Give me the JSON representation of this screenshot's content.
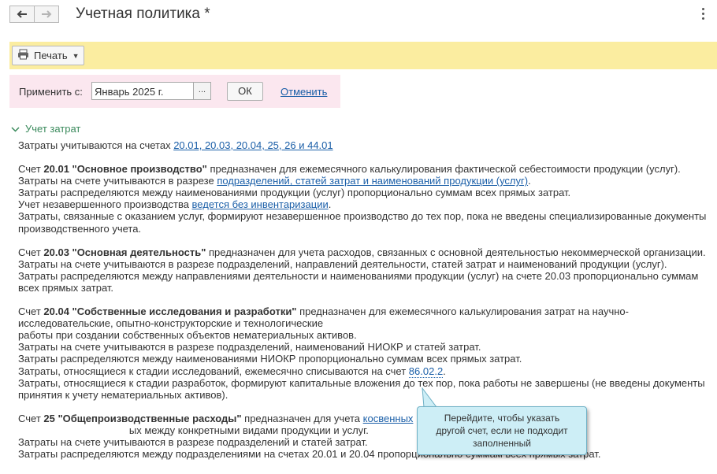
{
  "window": {
    "title": "Учетная политика *"
  },
  "nav": {
    "back_icon": "arrow-left-icon",
    "forward_icon": "arrow-right-icon",
    "more_icon": "more-vertical-icon"
  },
  "toolbar": {
    "print_label": "Печать",
    "print_icon": "printer-icon"
  },
  "apply": {
    "label": "Применить с:",
    "date_value": "Январь 2025 г.",
    "picker_label": "...",
    "ok_label": "ОК",
    "cancel_label": "Отменить"
  },
  "section": {
    "title": "Учет затрат",
    "intro_text": "Затраты учитываются на счетах ",
    "intro_link": "20.01, 20.03, 20.04, 25, 26 и 44.01",
    "b1": {
      "prefix": "Счет ",
      "title": "20.01 \"Основное производство\"",
      "rest": " предназначен для ежемесячного калькулирования фактической себестоимости продукции (услуг).",
      "l2_text": "Затраты на счете учитываются в разрезе ",
      "l2_link": "подразделений, статей затрат и наименований продукции (услуг)",
      "l2_end": ".",
      "l3": "Затраты распределяются между наименованиями продукции (услуг) пропорционально суммам всех прямых затрат.",
      "l4_text": "Учет незавершенного производства ",
      "l4_link": "ведется без инвентаризации",
      "l4_end": ".",
      "l5": "Затраты, связанные с оказанием услуг, формируют незавершенное производство до тех пор, пока не введены специализированные документы производственного учета."
    },
    "b2": {
      "prefix": "Счет ",
      "title": "20.03 \"Основная деятельность\"",
      "rest": " предназначен для учета расходов, связанных с основной деятельностью некоммерческой организации.",
      "l2": "Затраты на счете учитываются в разрезе подразделений, направлений деятельности, статей затрат и наименований продукции (услуг).",
      "l3": "Затраты распределяются между направлениями деятельности и наименованиями продукции (услуг) на счете 20.03 пропорционально суммам всех прямых затрат."
    },
    "b3": {
      "prefix": "Счет ",
      "title": "20.04 \"Собственные исследования и разработки\"",
      "rest": " предназначен для ежемесячного калькулирования затрат на научно-",
      "l1b": "исследовательские, опытно-конструкторские и технологические",
      "l1c": "работы при создании собственных объектов нематериальных активов.",
      "l2": "Затраты на счете учитываются в разрезе подразделений, наименований НИОКР и статей затрат.",
      "l3": "Затраты распределяются между наименованиями НИОКР пропорционально суммам всех прямых затрат.",
      "l4_text": "Затраты, относящиеся к стадии исследований, ежемесячно списываются на счет ",
      "l4_link": "86.02.2",
      "l4_end": ".",
      "l5": "Затраты, относящиеся к стадии разработок, формируют капитальные вложения до тех пор, пока работы не завершены (не введены документы принятия к учету нематериальных активов)."
    },
    "b4": {
      "prefix": "Счет ",
      "title": "25 \"Общепроизводственные расходы\"",
      "rest_text": " предназначен для учета ",
      "rest_link": "косвенных",
      "rest_tail": "                                       ых между конкретными видами продукции и услуг.",
      "l2": "Затраты на счете учитываются в разрезе подразделений и статей затрат.",
      "l3": "Затраты распределяются между подразделениями на счетах 20.01 и 20.04 пропорционально суммам всех прямых затрат."
    }
  },
  "tooltip": {
    "line1": "Перейдите, чтобы указать",
    "line2": "другой счет, если не подходит",
    "line3": "заполненный"
  }
}
